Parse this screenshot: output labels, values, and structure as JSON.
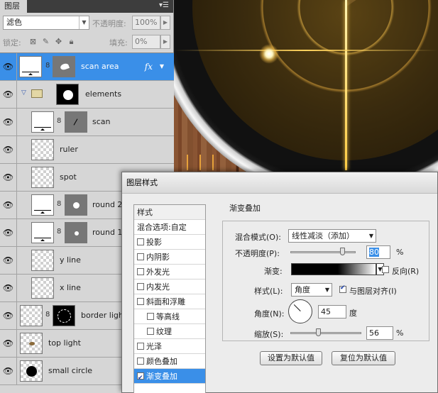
{
  "layers_panel": {
    "tab": "图层",
    "menu_icon": "panel-menu-icon",
    "blend_mode": "滤色",
    "opacity_label": "不透明度:",
    "opacity_value": "100%",
    "lock_label": "锁定:",
    "fill_label": "填充:",
    "fill_value": "0%",
    "fx_label": "fx",
    "layers": [
      {
        "name": "scan area",
        "selected": true,
        "fx": true
      },
      {
        "name": "elements",
        "group": true
      },
      {
        "name": "scan"
      },
      {
        "name": "ruler"
      },
      {
        "name": "spot"
      },
      {
        "name": "round 2"
      },
      {
        "name": "round 1"
      },
      {
        "name": "y line"
      },
      {
        "name": "x line"
      },
      {
        "name": "border light"
      },
      {
        "name": "top light"
      },
      {
        "name": "small circle"
      }
    ]
  },
  "dialog": {
    "title": "图层样式",
    "styles_header": "样式",
    "styles": [
      {
        "label": "混合选项:自定",
        "checkbox": false
      },
      {
        "label": "投影",
        "checkbox": true,
        "checked": false
      },
      {
        "label": "内阴影",
        "checkbox": true,
        "checked": false
      },
      {
        "label": "外发光",
        "checkbox": true,
        "checked": false
      },
      {
        "label": "内发光",
        "checkbox": true,
        "checked": false
      },
      {
        "label": "斜面和浮雕",
        "checkbox": true,
        "checked": false
      },
      {
        "label": "等高线",
        "checkbox": true,
        "checked": false,
        "indent": true
      },
      {
        "label": "纹理",
        "checkbox": true,
        "checked": false,
        "indent": true
      },
      {
        "label": "光泽",
        "checkbox": true,
        "checked": false
      },
      {
        "label": "颜色叠加",
        "checkbox": true,
        "checked": false
      },
      {
        "label": "渐变叠加",
        "checkbox": true,
        "checked": true,
        "selected": true
      }
    ],
    "section_title": "渐变叠加",
    "group_title": "渐变",
    "blend_label": "混合模式(O):",
    "blend_value": "线性减淡（添加）",
    "opacity_label": "不透明度(P):",
    "opacity_value": "80",
    "opacity_unit": "%",
    "opacity_fraction": 0.8,
    "gradient_label": "渐变:",
    "reverse_label": "反向(R)",
    "style_label": "样式(L):",
    "style_value": "角度",
    "align_label": "与图层对齐(I)",
    "angle_label": "角度(N):",
    "angle_value": "45",
    "angle_unit": "度",
    "scale_label": "缩放(S):",
    "scale_value": "56",
    "scale_unit": "%",
    "scale_fraction": 0.56,
    "default_button": "设置为默认值",
    "reset_button": "复位为默认值"
  }
}
